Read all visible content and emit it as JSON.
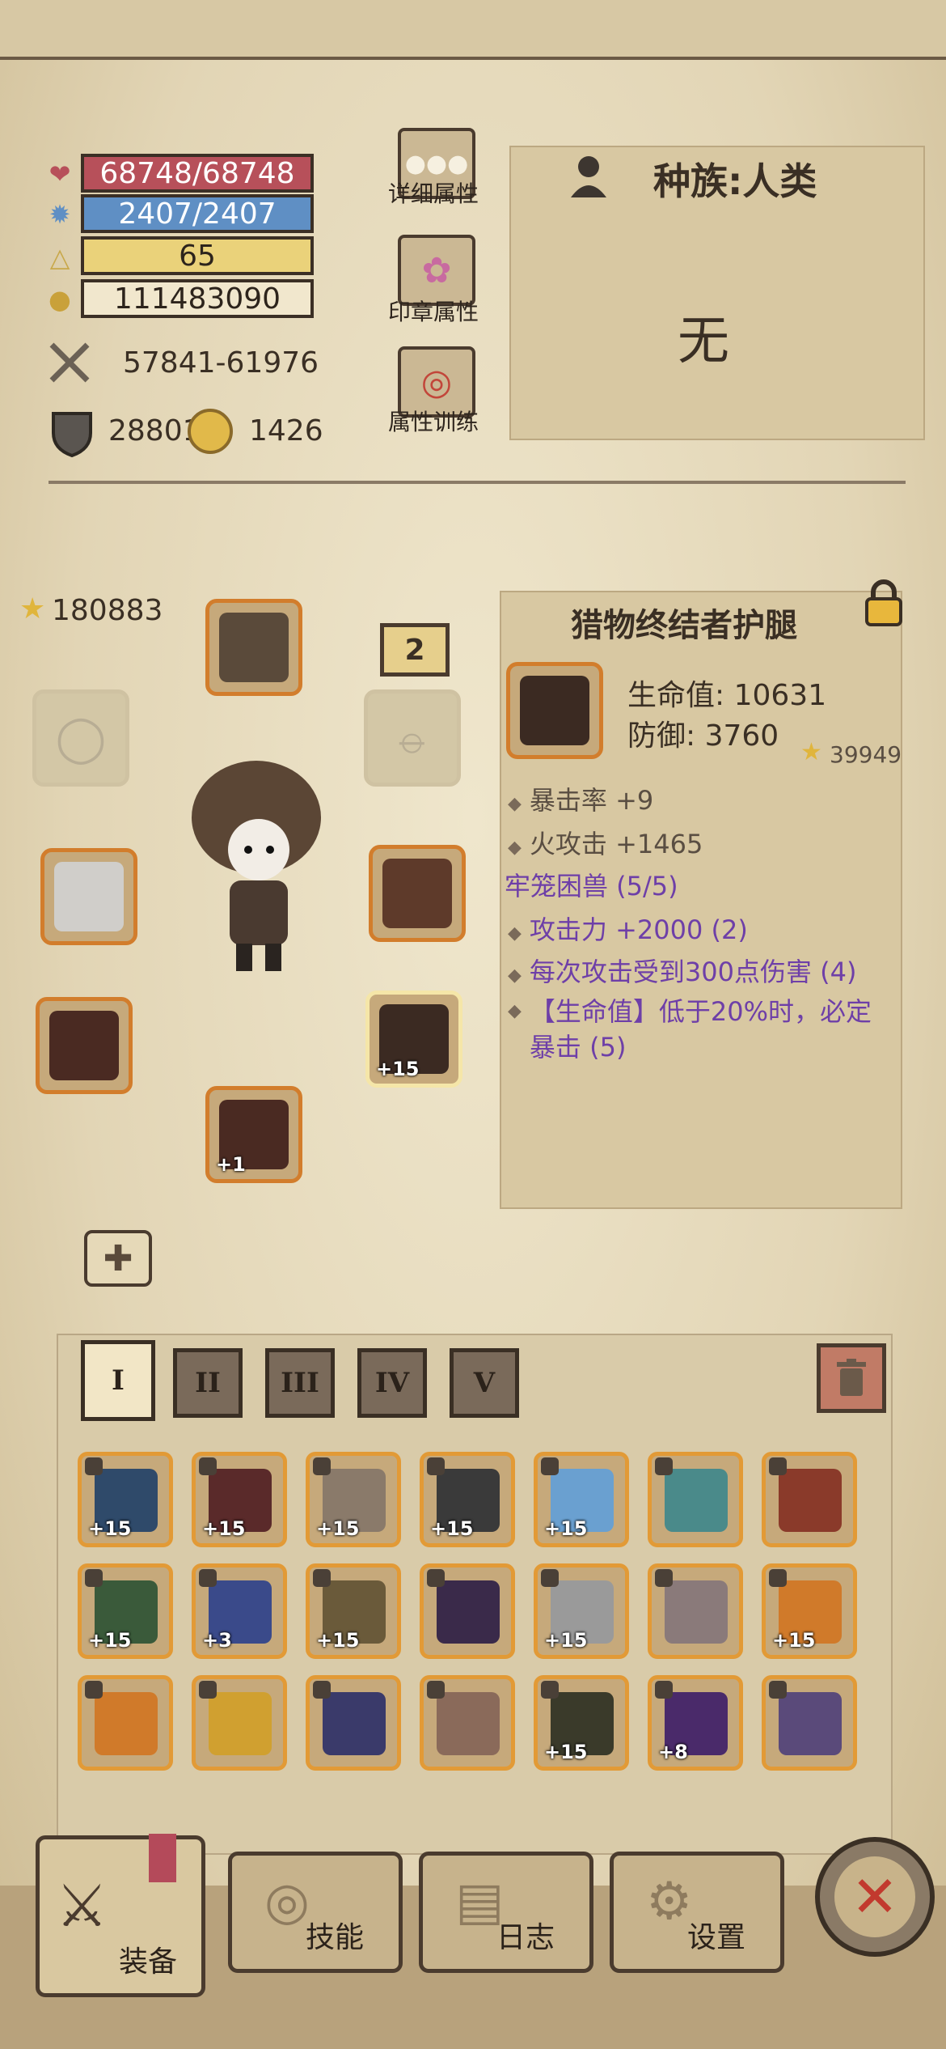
{
  "stats": {
    "hp": "68748/68748",
    "mp": "2407/2407",
    "level": "65",
    "gold": "111483090",
    "attack": "57841-61976",
    "defense": "28801",
    "energy": "1426"
  },
  "side_buttons": {
    "detail": "详细属性",
    "seal": "印章属性",
    "train": "属性训练"
  },
  "race": {
    "title": "种族:人类",
    "value": "无"
  },
  "power_score": "180883",
  "page_badge": "2",
  "item_detail": {
    "name": "猎物终结者护腿",
    "hp": "生命值: 10631",
    "defense": "防御: 3760",
    "score": "39949",
    "attrs": [
      "暴击率 +9",
      "火攻击 +1465"
    ],
    "set_name": "牢笼困兽 (5/5)",
    "set_bonuses": [
      "攻击力 +2000 (2)",
      "每次攻击受到300点伤害 (4)",
      "【生命值】低于20%时，必定暴击 (5)"
    ]
  },
  "equip_slots": {
    "boots_plus": "+1",
    "legs_plus": "+15"
  },
  "tabs": [
    "I",
    "II",
    "III",
    "IV",
    "V"
  ],
  "inventory": [
    {
      "plus": "+15",
      "color": "#2f4a6a"
    },
    {
      "plus": "+15",
      "color": "#5a2a2a"
    },
    {
      "plus": "+15",
      "color": "#8a7a6a"
    },
    {
      "plus": "+15",
      "color": "#3a3a3a"
    },
    {
      "plus": "+15",
      "color": "#6aa0d0"
    },
    {
      "plus": "",
      "color": "#4a8a8a"
    },
    {
      "plus": "",
      "color": "#8a3a2a"
    },
    {
      "plus": "+15",
      "color": "#3a5a3a"
    },
    {
      "plus": "+3",
      "color": "#3a4a8a"
    },
    {
      "plus": "+15",
      "color": "#6a5a3a"
    },
    {
      "plus": "",
      "color": "#3a2a4a"
    },
    {
      "plus": "+15",
      "color": "#9a9a9a"
    },
    {
      "plus": "",
      "color": "#8a7a7a"
    },
    {
      "plus": "+15",
      "color": "#d07a2a"
    },
    {
      "plus": "",
      "color": "#d07a2a"
    },
    {
      "plus": "",
      "color": "#d0a030"
    },
    {
      "plus": "",
      "color": "#3a3a6a"
    },
    {
      "plus": "",
      "color": "#8a6a5a"
    },
    {
      "plus": "+15",
      "color": "#3a3a2a"
    },
    {
      "plus": "+8",
      "color": "#4a2a6a"
    },
    {
      "plus": "",
      "color": "#5a4a7a"
    }
  ],
  "bottom_nav": {
    "equip": "装备",
    "skill": "技能",
    "log": "日志",
    "settings": "设置"
  },
  "colors": {
    "hp_bar": "#b7505a",
    "mp_bar": "#5f8fc4",
    "level_bar": "#ead27a",
    "slot_border": "#d27d2c",
    "set_text": "#6e3fa8"
  }
}
